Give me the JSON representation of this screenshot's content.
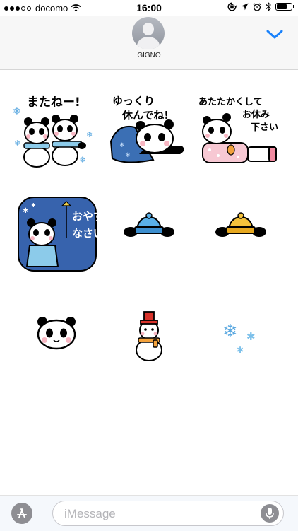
{
  "status_bar": {
    "carrier": "docomo",
    "time": "16:00",
    "signal_bars_filled": 3,
    "signal_bars_total": 5,
    "battery_level": 0.75
  },
  "header": {
    "contact_name": "GIGNO",
    "collapse_icon": "chevron-down-icon",
    "accent_color": "#1a82fb"
  },
  "stickers": [
    {
      "id": "sticker-matane",
      "caption": [
        "またねー!"
      ]
    },
    {
      "id": "sticker-yukkuri",
      "caption": [
        "ゆっくり",
        "休んでね!"
      ]
    },
    {
      "id": "sticker-atatakaku",
      "caption": [
        "あたたかくして",
        "お休み",
        "下さい"
      ]
    },
    {
      "id": "sticker-oyasumi",
      "caption": [
        "おやすみ",
        "なさい"
      ]
    },
    {
      "id": "sticker-blue-hat",
      "caption": []
    },
    {
      "id": "sticker-yellow-hat",
      "caption": []
    },
    {
      "id": "sticker-panda-face",
      "caption": []
    },
    {
      "id": "sticker-snowman",
      "caption": []
    },
    {
      "id": "sticker-snowflakes",
      "caption": []
    }
  ],
  "composer": {
    "placeholder": "iMessage",
    "appstore_icon": "app-store-icon",
    "mic_icon": "microphone-icon"
  }
}
